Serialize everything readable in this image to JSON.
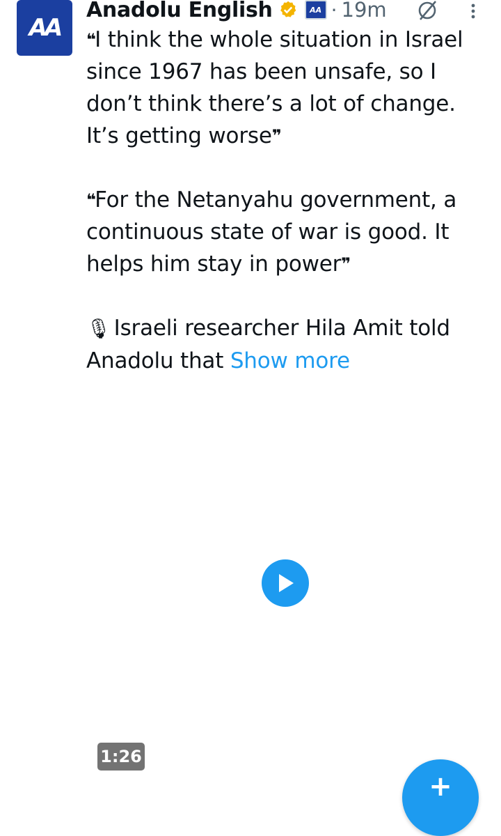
{
  "tweet": {
    "author_name": "Anadolu English",
    "avatar_text": "AA",
    "affiliate_badge_text": "AA",
    "separator": "·",
    "time": "19m",
    "paragraphs": [
      {
        "open_quote": "❝",
        "text": "I think the whole situation in Israel since 1967 has been unsafe, so I don’t think there’s a lot of change. It’s getting worse",
        "close_quote": "❞"
      },
      {
        "open_quote": "❝",
        "text": "For the Netanyahu government, a continuous state of war is good. It helps him stay in power",
        "close_quote": "❞"
      }
    ],
    "mic_emoji": "🎙",
    "last_text": " Israeli researcher Hila Amit told Anadolu that ",
    "show_more": "Show more"
  },
  "video": {
    "duration": "1:26"
  },
  "fab": {
    "label": "+"
  },
  "colors": {
    "accent": "#1d9bf0",
    "brand": "#1b3fa0",
    "verified": "#f4b400",
    "muted": "#536471"
  }
}
